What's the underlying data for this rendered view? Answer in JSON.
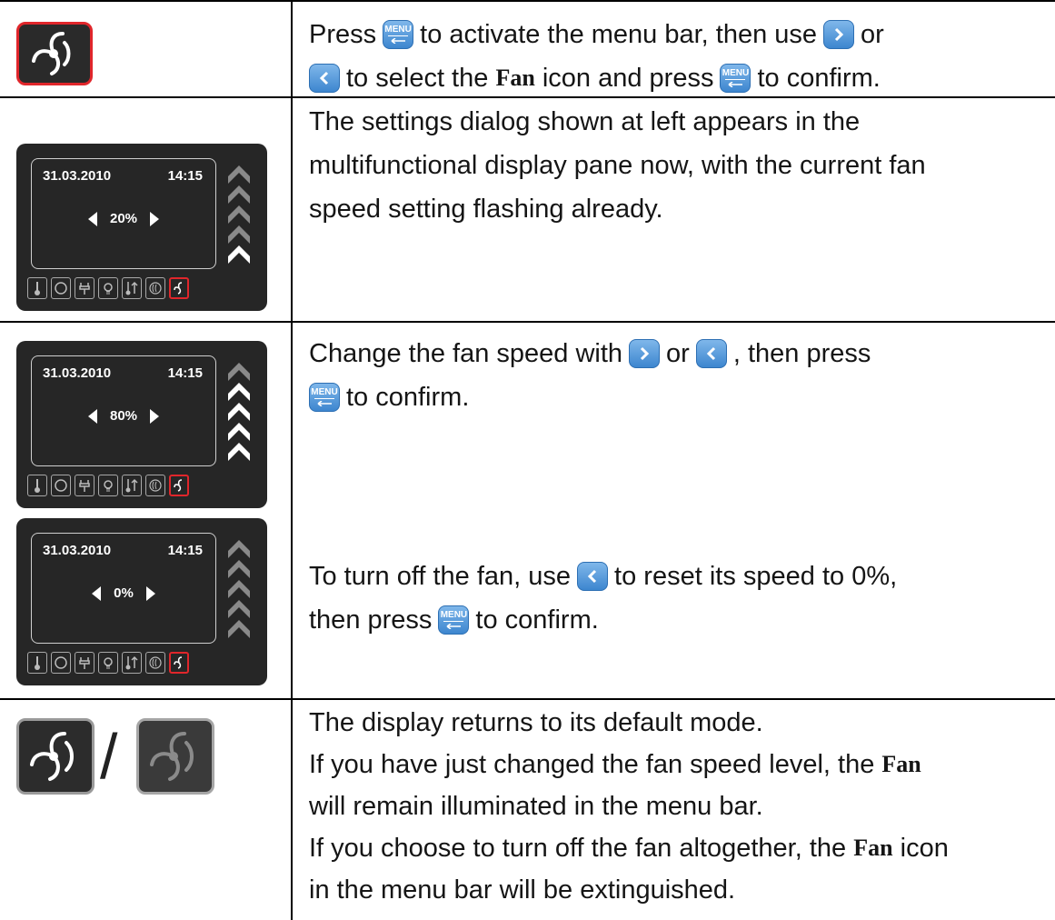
{
  "row1": {
    "line1": {
      "a": "Press",
      "b": "to activate the menu bar, then use",
      "c": "or"
    },
    "line2": {
      "a": "to select the",
      "fan": "Fan",
      "b": "icon and press",
      "c": "to confirm."
    }
  },
  "row2": {
    "lines": [
      "The settings dialog shown at left appears in the",
      "multifunctional display pane now, with the current fan",
      "speed setting flashing already."
    ],
    "display": {
      "date": "31.03.2010",
      "time": "14:15",
      "speed": "20%"
    }
  },
  "row3": {
    "line1": {
      "a": "Change the fan speed with",
      "b": "or",
      "c": ", then press"
    },
    "line2": {
      "a": "to confirm."
    },
    "line3": {
      "a": "To turn off the fan, use",
      "b": "to reset its speed to 0%,"
    },
    "line4": {
      "a": "then press",
      "b": "to confirm."
    },
    "display_a": {
      "date": "31.03.2010",
      "time": "14:15",
      "speed": "80%"
    },
    "display_b": {
      "date": "31.03.2010",
      "time": "14:15",
      "speed": "0%"
    }
  },
  "row4": {
    "line1": "The display returns to its default mode.",
    "line2a": "If you have just changed the fan speed level, the",
    "line2fan": "Fan",
    "line3": "will remain illuminated in the menu bar.",
    "line4a": "If you choose to turn off the fan altogether, the",
    "line4fan": "Fan",
    "line4b": "icon",
    "line5": "in the menu bar will be extinguished.",
    "separator": "/"
  },
  "keys": {
    "menu_label": "MENU"
  },
  "colors": {
    "key_blue": "#4a90d9",
    "active_red": "#e0262b",
    "device_bg": "#262626"
  }
}
